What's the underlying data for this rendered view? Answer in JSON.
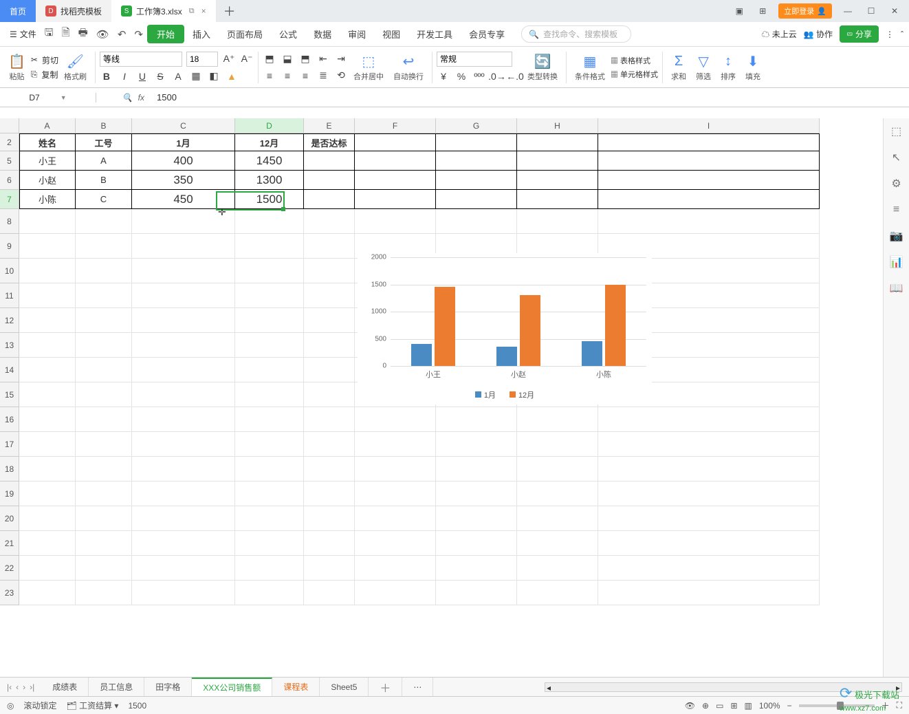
{
  "tabs": {
    "home": "首页",
    "templates": "找稻壳模板",
    "workbook": "工作簿3.xlsx",
    "dup_icon": "⧉",
    "close": "×",
    "plus": "＋"
  },
  "window": {
    "login": "立即登录",
    "min": "—",
    "max": "☐",
    "close": "✕"
  },
  "menu": {
    "file": "文件",
    "tabs": [
      "开始",
      "插入",
      "页面布局",
      "公式",
      "数据",
      "审阅",
      "视图",
      "开发工具",
      "会员专享"
    ],
    "active": "开始",
    "search_ph": "查找命令、搜索模板",
    "cloud": "未上云",
    "collab": "协作",
    "share": "分享"
  },
  "ribbon": {
    "paste": "粘贴",
    "cut": "剪切",
    "copy": "复制",
    "fmtpainter": "格式刷",
    "font": "等线",
    "size": "18",
    "merge": "合并居中",
    "wrap": "自动换行",
    "numfmt": "常规",
    "typeconv": "类型转换",
    "condfmt": "条件格式",
    "tablestyle": "表格样式",
    "cellstyle": "单元格样式",
    "sum": "求和",
    "filter": "筛选",
    "sort": "排序",
    "fill": "填充"
  },
  "fx": {
    "cellref": "D7",
    "value": "1500"
  },
  "columns": [
    "A",
    "B",
    "C",
    "D",
    "E",
    "F",
    "G",
    "H",
    "I"
  ],
  "row_numbers": [
    "2",
    "5",
    "6",
    "7",
    "8",
    "9",
    "10",
    "11",
    "12",
    "13",
    "14",
    "15",
    "16",
    "17",
    "18",
    "19",
    "20",
    "21",
    "22",
    "23"
  ],
  "table": {
    "headers": [
      "姓名",
      "工号",
      "1月",
      "12月",
      "是否达标"
    ],
    "rows": [
      {
        "name": "小王",
        "id": "A",
        "m1": "400",
        "m12": "1450",
        "ok": ""
      },
      {
        "name": "小赵",
        "id": "B",
        "m1": "350",
        "m12": "1300",
        "ok": ""
      },
      {
        "name": "小陈",
        "id": "C",
        "m1": "450",
        "m12": "1500",
        "ok": ""
      }
    ]
  },
  "sheets": {
    "list": [
      "成绩表",
      "员工信息",
      "田字格",
      "XXX公司销售额",
      "课程表",
      "Sheet5"
    ],
    "active": "XXX公司销售额",
    "orange": "课程表"
  },
  "status": {
    "lock": "滚动锁定",
    "calc": "工资结算",
    "val": "1500",
    "zoom": "100%"
  },
  "chart_data": {
    "type": "bar",
    "categories": [
      "小王",
      "小赵",
      "小陈"
    ],
    "series": [
      {
        "name": "1月",
        "values": [
          400,
          350,
          450
        ],
        "color": "#4a8bc4"
      },
      {
        "name": "12月",
        "values": [
          1450,
          1300,
          1500
        ],
        "color": "#ec7c30"
      }
    ],
    "ylim": [
      0,
      2000
    ],
    "yticks": [
      0,
      500,
      1000,
      1500,
      2000
    ]
  },
  "watermark": {
    "site": "极光下载站",
    "url": "www.xz7.com"
  }
}
